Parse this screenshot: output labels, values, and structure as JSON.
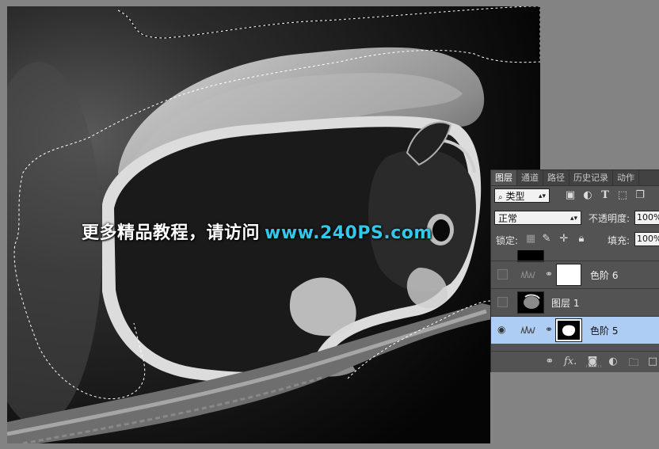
{
  "watermark": {
    "zh": "更多精品教程，请访问",
    "url": "www.240PS.com"
  },
  "layers_panel": {
    "tabs": [
      {
        "label": "图层",
        "active": true
      },
      {
        "label": "通道",
        "active": false
      },
      {
        "label": "路径",
        "active": false
      },
      {
        "label": "历史记录",
        "active": false
      },
      {
        "label": "动作",
        "active": false
      }
    ],
    "filter": {
      "icon": "search-icon",
      "label": "类型"
    },
    "filter_icons": [
      "image-filter-icon",
      "adjustment-filter-icon",
      "text-filter-icon",
      "shape-filter-icon",
      "smart-object-filter-icon"
    ],
    "blend_mode": "正常",
    "opacity_label": "不透明度:",
    "opacity_value": "100%",
    "lock_label": "锁定:",
    "lock_icons": [
      "lock-transparent-icon",
      "lock-image-icon",
      "lock-position-icon",
      "lock-all-icon"
    ],
    "fill_label": "填充:",
    "fill_value": "100%",
    "layers": [
      {
        "name": "色阶 6",
        "visible": false,
        "type": "levels-adjustment",
        "mask": "white"
      },
      {
        "name": "图层 1",
        "visible": false,
        "type": "pixel",
        "mask": "none"
      },
      {
        "name": "色阶 5",
        "visible": true,
        "type": "levels-adjustment",
        "mask": "black-with-white-shape",
        "selected": true
      }
    ],
    "footer_icons": [
      "link-layers-icon",
      "fx-icon",
      "add-mask-icon",
      "adjustment-layer-icon",
      "new-group-icon",
      "new-layer-icon",
      "trash-icon"
    ],
    "footer_fx_label": "fx."
  },
  "colors": {
    "canvas_bg": "#838383",
    "panel_bg": "#535353",
    "selection_highlight": "#aecdf5",
    "watermark_url": "#33c8e8"
  }
}
